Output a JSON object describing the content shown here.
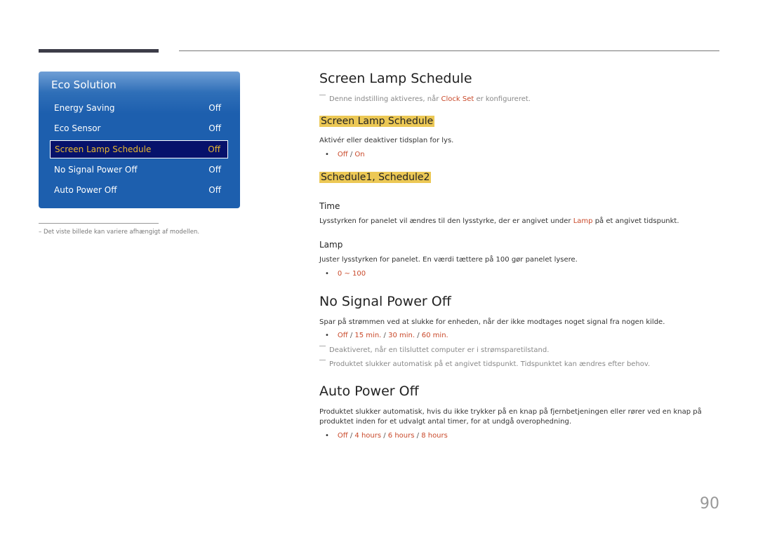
{
  "sidebar": {
    "panel_title": "Eco Solution",
    "items": [
      {
        "label": "Energy Saving",
        "value": "Off",
        "selected": false
      },
      {
        "label": "Eco Sensor",
        "value": "Off",
        "selected": false
      },
      {
        "label": "Screen Lamp Schedule",
        "value": "Off",
        "selected": true
      },
      {
        "label": "No Signal Power Off",
        "value": "Off",
        "selected": false
      },
      {
        "label": "Auto Power Off",
        "value": "Off",
        "selected": false
      }
    ],
    "footnote": "–  Det viste billede kan variere afhængigt af modellen."
  },
  "sections": {
    "screen_lamp": {
      "title": "Screen Lamp Schedule",
      "note_pre": "Denne indstilling aktiveres, når ",
      "note_link": "Clock Set",
      "note_post": " er konfigureret.",
      "sub1_title": "Screen Lamp Schedule",
      "sub1_text": "Aktivér eller deaktiver tidsplan for lys.",
      "sub1_options": [
        "Off",
        "On"
      ],
      "sub2_title": "Schedule1, Schedule2",
      "time_title": "Time",
      "time_pre": "Lysstyrken for panelet vil ændres til den lysstyrke, der er angivet under ",
      "time_link": "Lamp",
      "time_post": " på et angivet tidspunkt.",
      "lamp_title": "Lamp",
      "lamp_text": "Juster lysstyrken for panelet. En værdi tættere på 100 gør panelet lysere.",
      "lamp_range": "0 ~ 100"
    },
    "no_signal": {
      "title": "No Signal Power Off",
      "text": "Spar på strømmen ved at slukke for enheden, når der ikke modtages noget signal fra nogen kilde.",
      "options": [
        "Off",
        "15 min.",
        "30 min.",
        "60 min."
      ],
      "note1": "Deaktiveret, når en tilsluttet computer er i strømsparetilstand.",
      "note2": "Produktet slukker automatisk på et angivet tidspunkt. Tidspunktet kan ændres efter behov."
    },
    "auto_power": {
      "title": "Auto Power Off",
      "text1": "Produktet slukker automatisk, hvis du ikke trykker på en knap på fjernbetjeningen eller rører ved en knap på",
      "text2": "produktet inden for et udvalgt antal timer, for at undgå overophedning.",
      "options": [
        "Off",
        "4 hours",
        "6 hours",
        "8 hours"
      ]
    }
  },
  "page_number": "90",
  "colors": {
    "accent": "#c9492a",
    "highlight": "#ecc855",
    "panel": "#1d5fae",
    "selected_bg": "#06126b"
  }
}
